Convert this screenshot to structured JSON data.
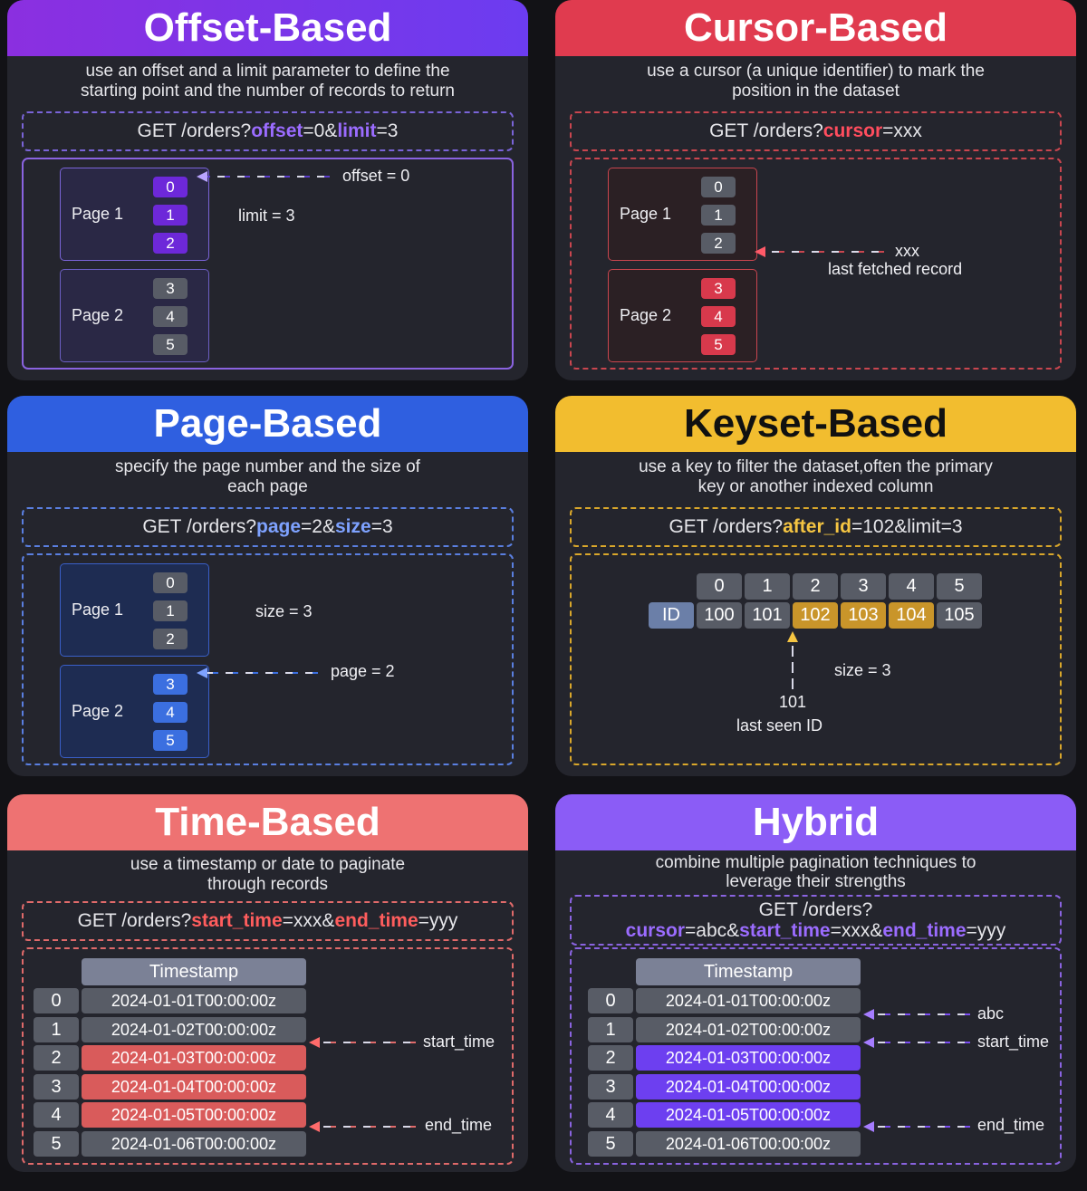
{
  "colors": {
    "offset": "#7c3aed",
    "cursor": "#e03b4f",
    "page": "#2f5fe0",
    "keyset": "#f2bd2f",
    "time": "#ee7272",
    "hybrid": "#8b5cf6"
  },
  "offset": {
    "title": "Offset-Based",
    "desc1": "use an offset and a limit parameter to define the",
    "desc2": "starting point and the number of records to return",
    "api": [
      "GET /orders?",
      "offset",
      "=0&",
      "limit",
      "=3"
    ],
    "page1": "Page 1",
    "page2": "Page 2",
    "rows": [
      "0",
      "1",
      "2",
      "3",
      "4",
      "5"
    ],
    "offset_note": "offset = 0",
    "limit_note": "limit = 3"
  },
  "cursor": {
    "title": "Cursor-Based",
    "desc1": "use a cursor (a unique identifier) to mark the",
    "desc2": "position in the dataset",
    "api": [
      "GET /orders?",
      "cursor",
      "=xxx"
    ],
    "page1": "Page 1",
    "page2": "Page 2",
    "rows": [
      "0",
      "1",
      "2",
      "3",
      "4",
      "5"
    ],
    "cursor_value": "xxx",
    "cursor_note": "last fetched record"
  },
  "page": {
    "title": "Page-Based",
    "desc1": "specify the page number and the size of",
    "desc2": "each page",
    "api": [
      "GET /orders?",
      "page",
      "=2&",
      "size",
      "=3"
    ],
    "page1": "Page 1",
    "page2": "Page 2",
    "rows": [
      "0",
      "1",
      "2",
      "3",
      "4",
      "5"
    ],
    "size_note": "size = 3",
    "page_note": "page = 2"
  },
  "keyset": {
    "title": "Keyset-Based",
    "desc1": "use a key to filter the dataset,often the primary",
    "desc2": "key or another indexed column",
    "api": [
      "GET /orders?",
      "after_id",
      "=102&limit=3"
    ],
    "indices": [
      "0",
      "1",
      "2",
      "3",
      "4",
      "5"
    ],
    "id_label": "ID",
    "ids": [
      "100",
      "101",
      "102",
      "103",
      "104",
      "105"
    ],
    "size_note": "size = 3",
    "last_seen_value": "101",
    "last_seen_note": "last seen ID"
  },
  "time": {
    "title": "Time-Based",
    "desc1": "use a timestamp or date to paginate",
    "desc2": "through records",
    "api": [
      "GET /orders?",
      "start_time",
      "=xxx&",
      "end_time",
      "=yyy"
    ],
    "table_header": "Timestamp",
    "indices": [
      "0",
      "1",
      "2",
      "3",
      "4",
      "5"
    ],
    "timestamps": [
      "2024-01-01T00:00:00z",
      "2024-01-02T00:00:00z",
      "2024-01-03T00:00:00z",
      "2024-01-04T00:00:00z",
      "2024-01-05T00:00:00z",
      "2024-01-06T00:00:00z"
    ],
    "start_note": "start_time",
    "end_note": "end_time"
  },
  "hybrid": {
    "title": "Hybrid",
    "desc1": "combine multiple pagination techniques to",
    "desc2": "leverage their strengths",
    "api_line1": "GET /orders?",
    "api_line2": [
      "cursor",
      "=abc&",
      "start_time",
      "=xxx&",
      "end_time",
      "=yyy"
    ],
    "table_header": "Timestamp",
    "indices": [
      "0",
      "1",
      "2",
      "3",
      "4",
      "5"
    ],
    "timestamps": [
      "2024-01-01T00:00:00z",
      "2024-01-02T00:00:00z",
      "2024-01-03T00:00:00z",
      "2024-01-04T00:00:00z",
      "2024-01-05T00:00:00z",
      "2024-01-06T00:00:00z"
    ],
    "cursor_note": "abc",
    "start_note": "start_time",
    "end_note": "end_time"
  }
}
